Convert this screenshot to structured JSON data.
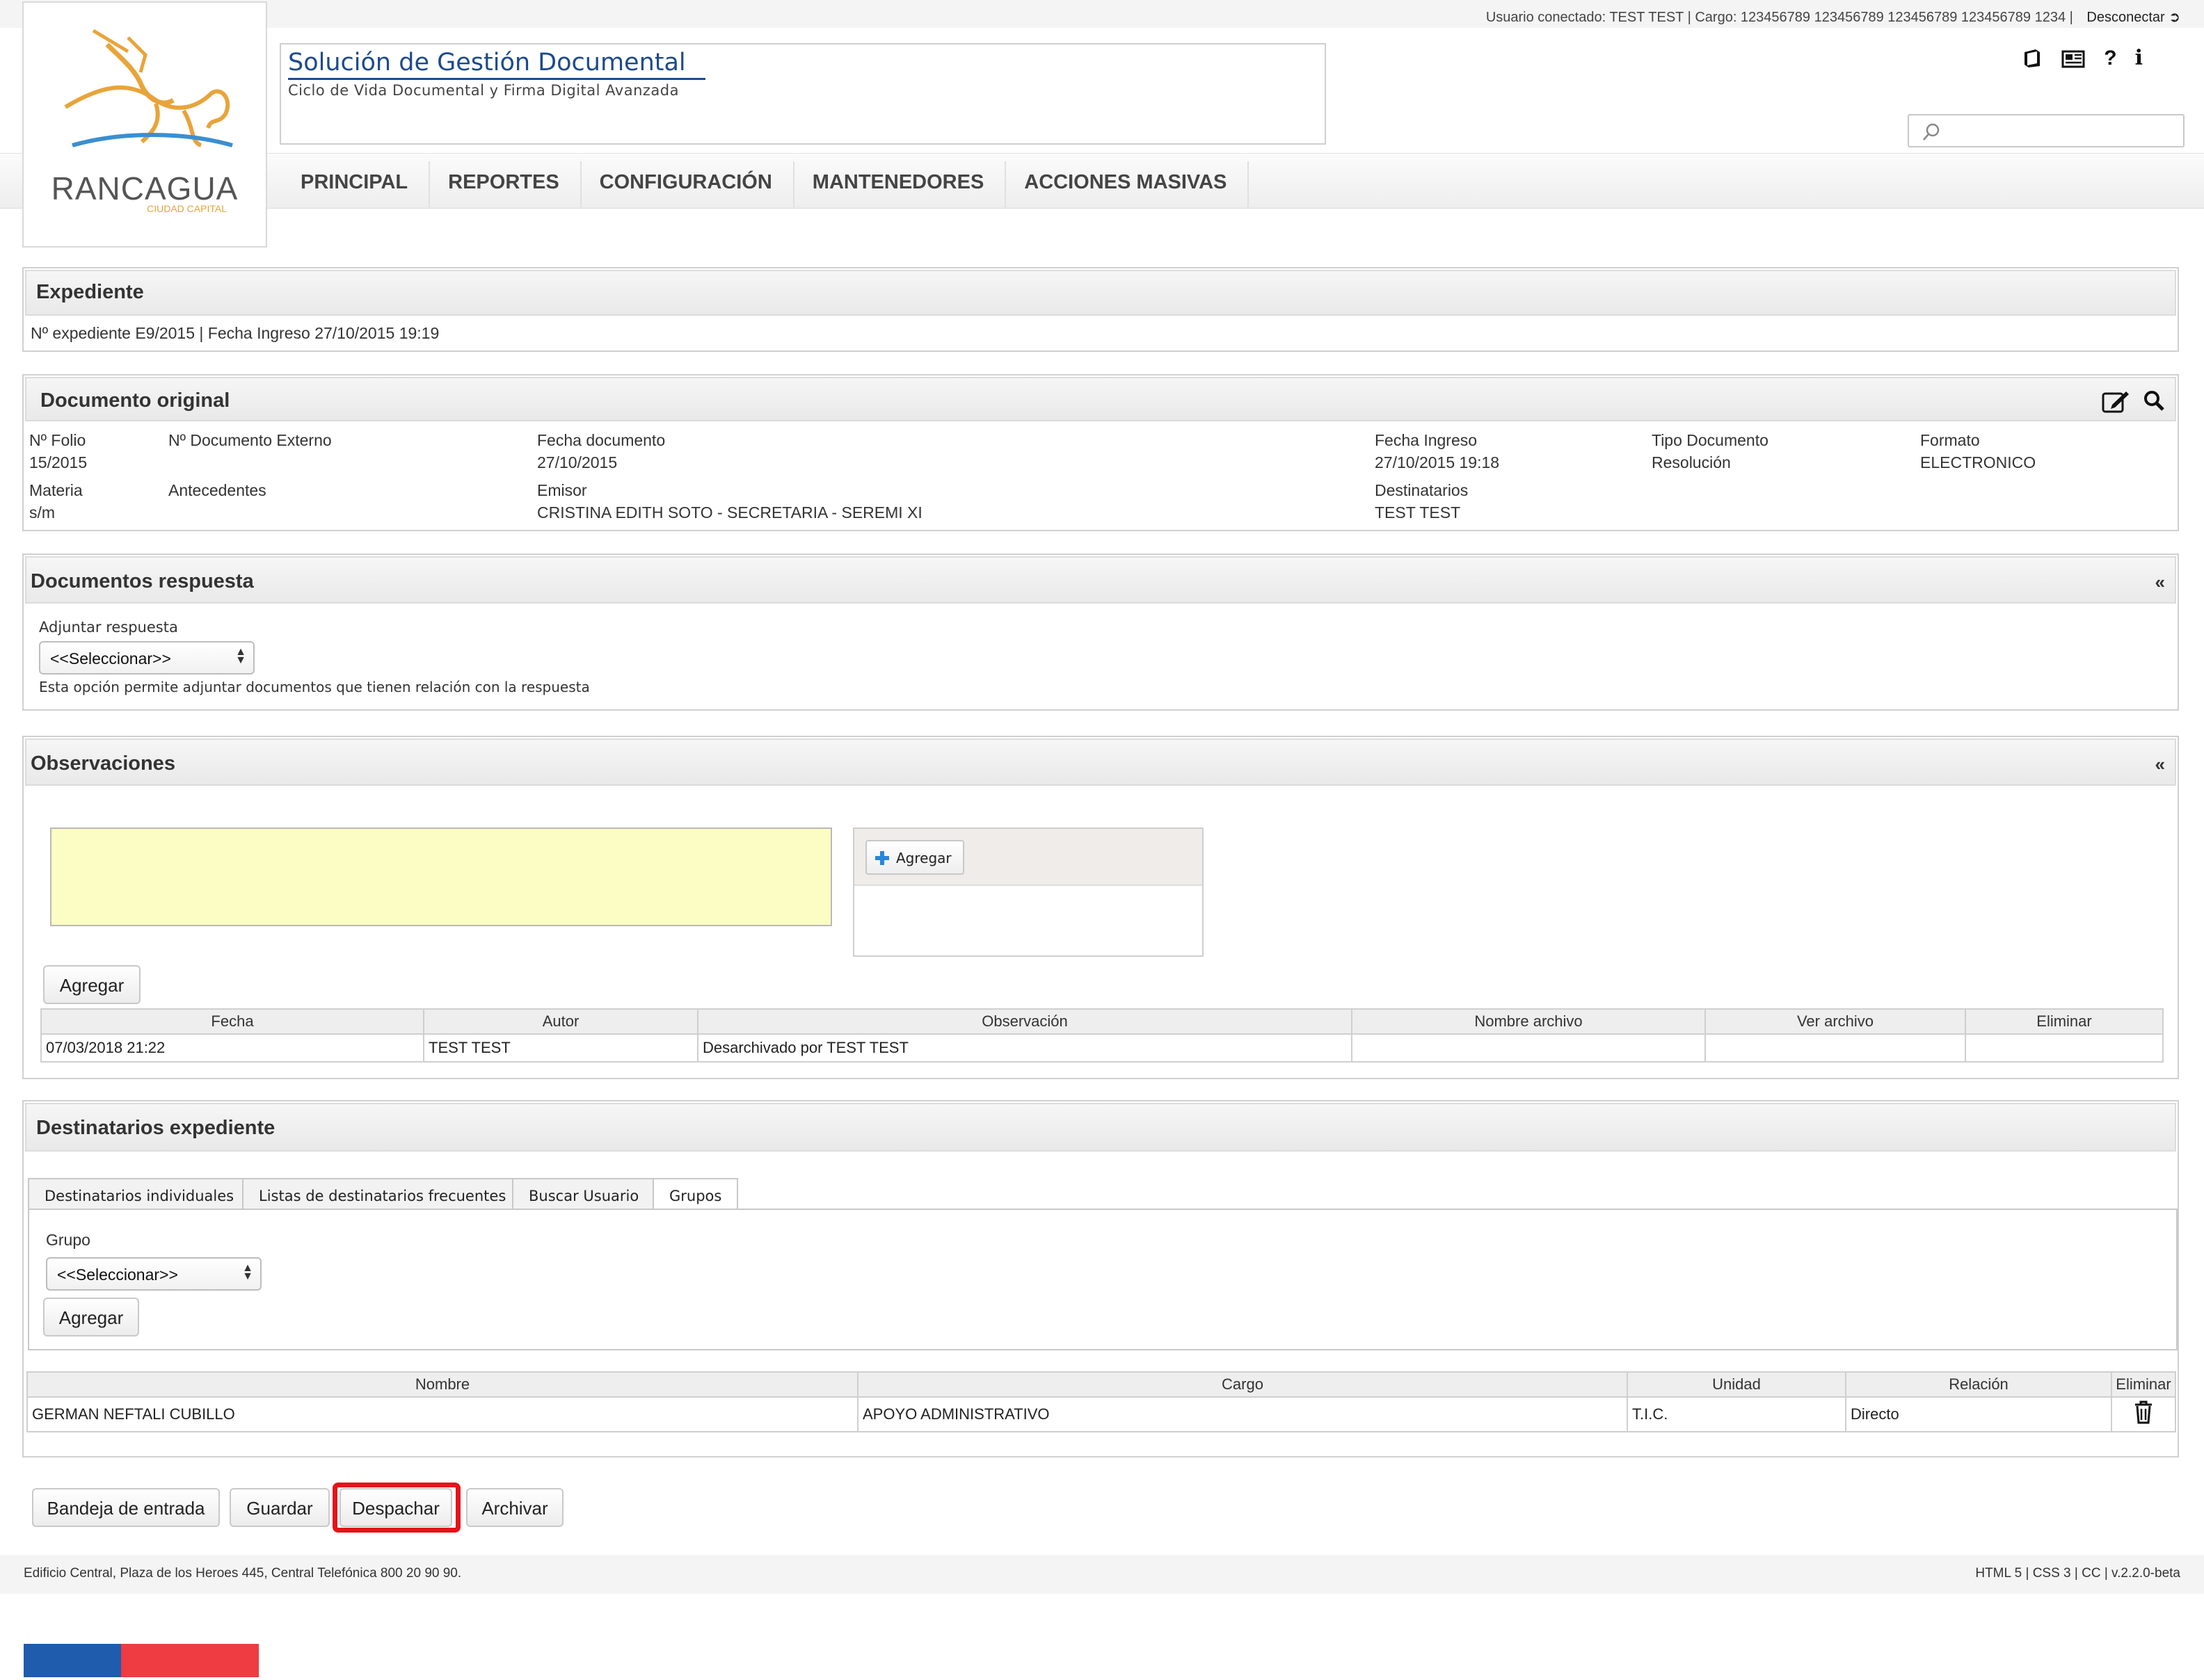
{
  "header": {
    "user_line": "Usuario conectado: TEST TEST | Cargo: 123456789 123456789 123456789 123456789 1234 |",
    "logout": "Desconectar",
    "logo_name": "RANCAGUA",
    "logo_sub": "CIUDAD CAPITAL",
    "app_title": "Solución de Gestión Documental",
    "app_subtitle": "Ciclo de Vida Documental y Firma Digital Avanzada",
    "icons": [
      "book-icon",
      "newspaper-icon",
      "help-icon",
      "info-icon"
    ],
    "search": {
      "placeholder": ""
    }
  },
  "nav": {
    "items": [
      "PRINCIPAL",
      "REPORTES",
      "CONFIGURACIÓN",
      "MANTENEDORES",
      "ACCIONES MASIVAS"
    ]
  },
  "expediente": {
    "title": "Expediente",
    "line": "Nº expediente  E9/2015 | Fecha Ingreso 27/10/2015 19:19"
  },
  "documento": {
    "title": "Documento original",
    "folio_label": "Nº Folio",
    "folio": "15/2015",
    "externo_label": "Nº Documento Externo",
    "fecha_doc_label": "Fecha documento",
    "fecha_doc": "27/10/2015",
    "fecha_ing_label": "Fecha Ingreso",
    "fecha_ing": "27/10/2015 19:18",
    "tipo_label": "Tipo Documento",
    "tipo": "Resolución",
    "formato_label": "Formato",
    "formato": "ELECTRONICO",
    "materia_label": "Materia",
    "materia": "s/m",
    "antecedentes_label": "Antecedentes",
    "emisor_label": "Emisor",
    "emisor": "CRISTINA EDITH SOTO - SECRETARIA - SEREMI XI",
    "destinatarios_label": "Destinatarios",
    "destinatarios": "TEST TEST"
  },
  "respuesta": {
    "title": "Documentos respuesta",
    "collapse": "«",
    "adjuntar_label": "Adjuntar respuesta",
    "select_value": "<<Seleccionar>>",
    "help": "Esta opción permite adjuntar documentos que tienen relación con la respuesta"
  },
  "observaciones": {
    "title": "Observaciones",
    "collapse": "«",
    "textarea_value": "",
    "upload_button": "Agregar",
    "add_button": "Agregar",
    "columns": [
      "Fecha",
      "Autor",
      "Observación",
      "Nombre archivo",
      "Ver archivo",
      "Eliminar"
    ],
    "rows": [
      [
        "07/03/2018 21:22",
        "TEST TEST",
        "Desarchivado por TEST TEST",
        "",
        "",
        ""
      ]
    ]
  },
  "destinatarios": {
    "title": "Destinatarios expediente",
    "tabs": [
      "Destinatarios individuales",
      "Listas de destinatarios frecuentes",
      "Buscar Usuario",
      "Grupos"
    ],
    "active_tab": "Grupos",
    "grupo_label": "Grupo",
    "select_value": "<<Seleccionar>>",
    "add_button": "Agregar",
    "columns": [
      "Nombre",
      "Cargo",
      "Unidad",
      "Relación",
      "Eliminar"
    ],
    "rows": [
      [
        "GERMAN NEFTALI CUBILLO",
        "APOYO ADMINISTRATIVO",
        "T.I.C.",
        "Directo"
      ]
    ]
  },
  "actions": {
    "bandeja": "Bandeja de entrada",
    "guardar": "Guardar",
    "despachar": "Despachar",
    "archivar": "Archivar"
  },
  "footer": {
    "address": "Edificio Central, Plaza de los Heroes 445, Central Telefónica 800 20 90 90.",
    "version": "HTML 5 | CSS 3 | CC | v.2.2.0-beta"
  },
  "colors": {
    "accent_blue": "#1d4a8c",
    "highlight_red": "#e3141b",
    "textarea_bg": "#fcfdc4",
    "flag_blue": "#1f5cad",
    "flag_red": "#ef3b42"
  }
}
